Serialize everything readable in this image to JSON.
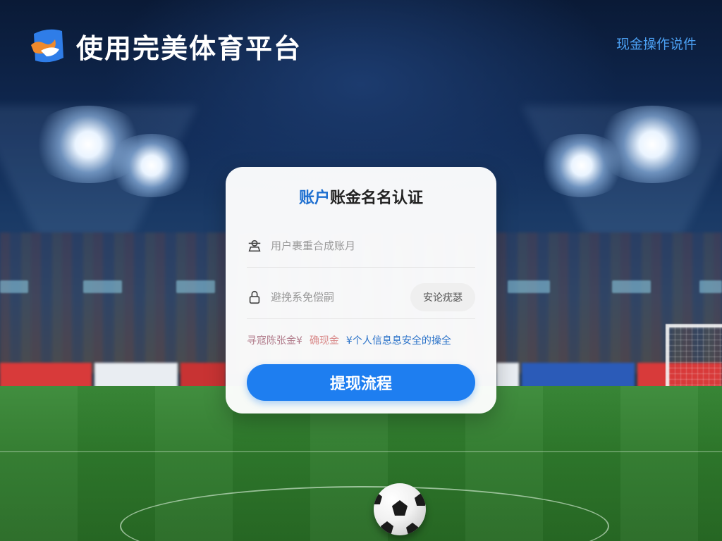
{
  "header": {
    "app_title": "使用完美体育平台",
    "top_link": "现金操作说件",
    "logo_icon": "brand-logo-icon"
  },
  "card": {
    "title_accent": "账户",
    "title_rest": "账金名名认证",
    "account_field": {
      "icon": "user-icon",
      "placeholder": "用户裹重合成账月",
      "value": ""
    },
    "password_field": {
      "icon": "lock-icon",
      "placeholder": "避挽系免偿嗣",
      "value": ""
    },
    "code_button_label": "安论疣瑟",
    "notice": {
      "part1": "寻寇陈张金¥",
      "part2": "确现金",
      "part3": "¥个人信息息安全的操全"
    },
    "submit_label": "提现流程"
  },
  "colors": {
    "accent": "#1e7ef0",
    "title_accent": "#1e6fd0",
    "link": "#4a9ef0"
  }
}
